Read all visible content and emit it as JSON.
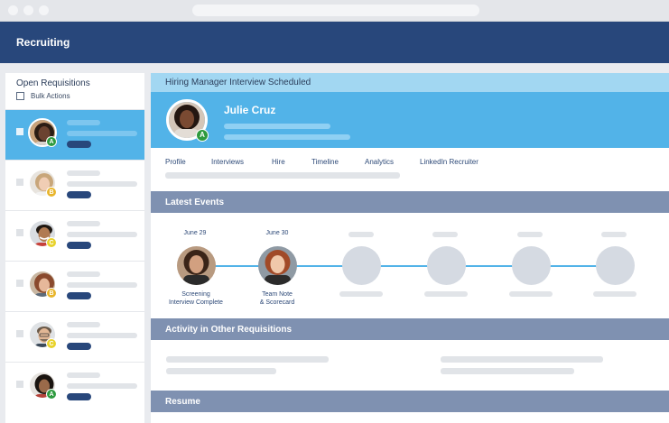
{
  "app": {
    "title": "Recruiting"
  },
  "sidebar": {
    "title": "Open Requisitions",
    "bulk_actions": "Bulk Actions",
    "rows": [
      {
        "badge": "A",
        "badge_color": "#2e9a3f",
        "selected": true
      },
      {
        "badge": "B",
        "badge_color": "#e8b52c",
        "selected": false
      },
      {
        "badge": "C",
        "badge_color": "#e8d22c",
        "selected": false
      },
      {
        "badge": "B",
        "badge_color": "#e8b52c",
        "selected": false
      },
      {
        "badge": "C",
        "badge_color": "#e8d22c",
        "selected": false
      },
      {
        "badge": "A",
        "badge_color": "#2e9a3f",
        "selected": false
      }
    ]
  },
  "candidate": {
    "stage": "Hiring Manager Interview Scheduled",
    "name": "Julie Cruz",
    "badge": "A",
    "badge_color": "#2e9a3f"
  },
  "tabs": [
    "Profile",
    "Interviews",
    "Hire",
    "Timeline",
    "Analytics",
    "LinkedIn Recruiter"
  ],
  "sections": {
    "latest_events": "Latest Events",
    "activity": "Activity in Other Requisitions",
    "resume": "Resume"
  },
  "events": [
    {
      "date": "June 29",
      "label_line1": "Screening",
      "label_line2": "Interview Complete"
    },
    {
      "date": "June 30",
      "label_line1": "Team Note",
      "label_line2": "& Scorecard"
    }
  ],
  "colors": {
    "header": "#28477b",
    "accent": "#52b3e8",
    "section": "#7f91b1"
  }
}
